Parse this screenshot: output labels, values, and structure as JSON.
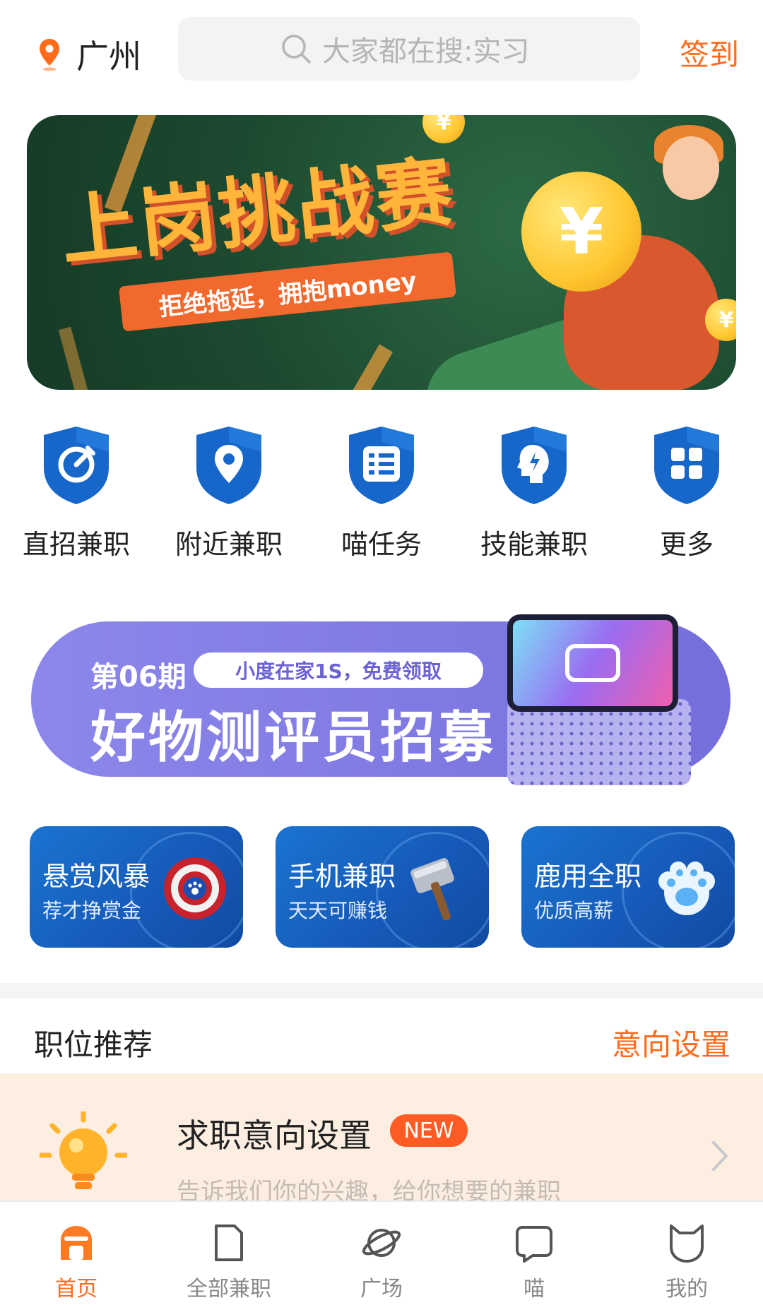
{
  "header": {
    "city": "广州",
    "search_placeholder": "大家都在搜:实习",
    "signin_label": "签到"
  },
  "banner_top": {
    "title": "上岗挑战赛",
    "subtitle": "拒绝拖延，拥抱money"
  },
  "categories": [
    {
      "label": "直招兼职",
      "icon": "stopwatch-icon"
    },
    {
      "label": "附近兼职",
      "icon": "location-pin-icon"
    },
    {
      "label": "喵任务",
      "icon": "task-list-icon"
    },
    {
      "label": "技能兼职",
      "icon": "skill-head-icon"
    },
    {
      "label": "更多",
      "icon": "grid-icon"
    }
  ],
  "banner_promo": {
    "issue": "第06期",
    "tag": "小度在家1S，免费领取",
    "title": "好物测评员招募"
  },
  "feature_cards": [
    {
      "title": "悬赏风暴",
      "subtitle": "荐才挣赏金",
      "icon": "shield-paw-icon"
    },
    {
      "title": "手机兼职",
      "subtitle": "天天可赚钱",
      "icon": "hammer-icon"
    },
    {
      "title": "鹿用全职",
      "subtitle": "优质高薪",
      "icon": "paw-cloud-icon"
    }
  ],
  "recommend": {
    "title": "职位推荐",
    "settings_label": "意向设置"
  },
  "intent_card": {
    "title": "求职意向设置",
    "badge": "NEW",
    "subtitle": "告诉我们你的兴趣，给你想要的兼职"
  },
  "tabbar": [
    {
      "label": "首页",
      "icon": "home-icon",
      "active": true
    },
    {
      "label": "全部兼职",
      "icon": "document-icon",
      "active": false
    },
    {
      "label": "广场",
      "icon": "planet-icon",
      "active": false
    },
    {
      "label": "喵",
      "icon": "chat-bubble-icon",
      "active": false
    },
    {
      "label": "我的",
      "icon": "cat-face-icon",
      "active": false
    }
  ],
  "colors": {
    "accent": "#ff6b1a",
    "card_blue": "#1659b8",
    "promo_purple": "#7f79e3",
    "banner_green": "#1c4a30"
  }
}
